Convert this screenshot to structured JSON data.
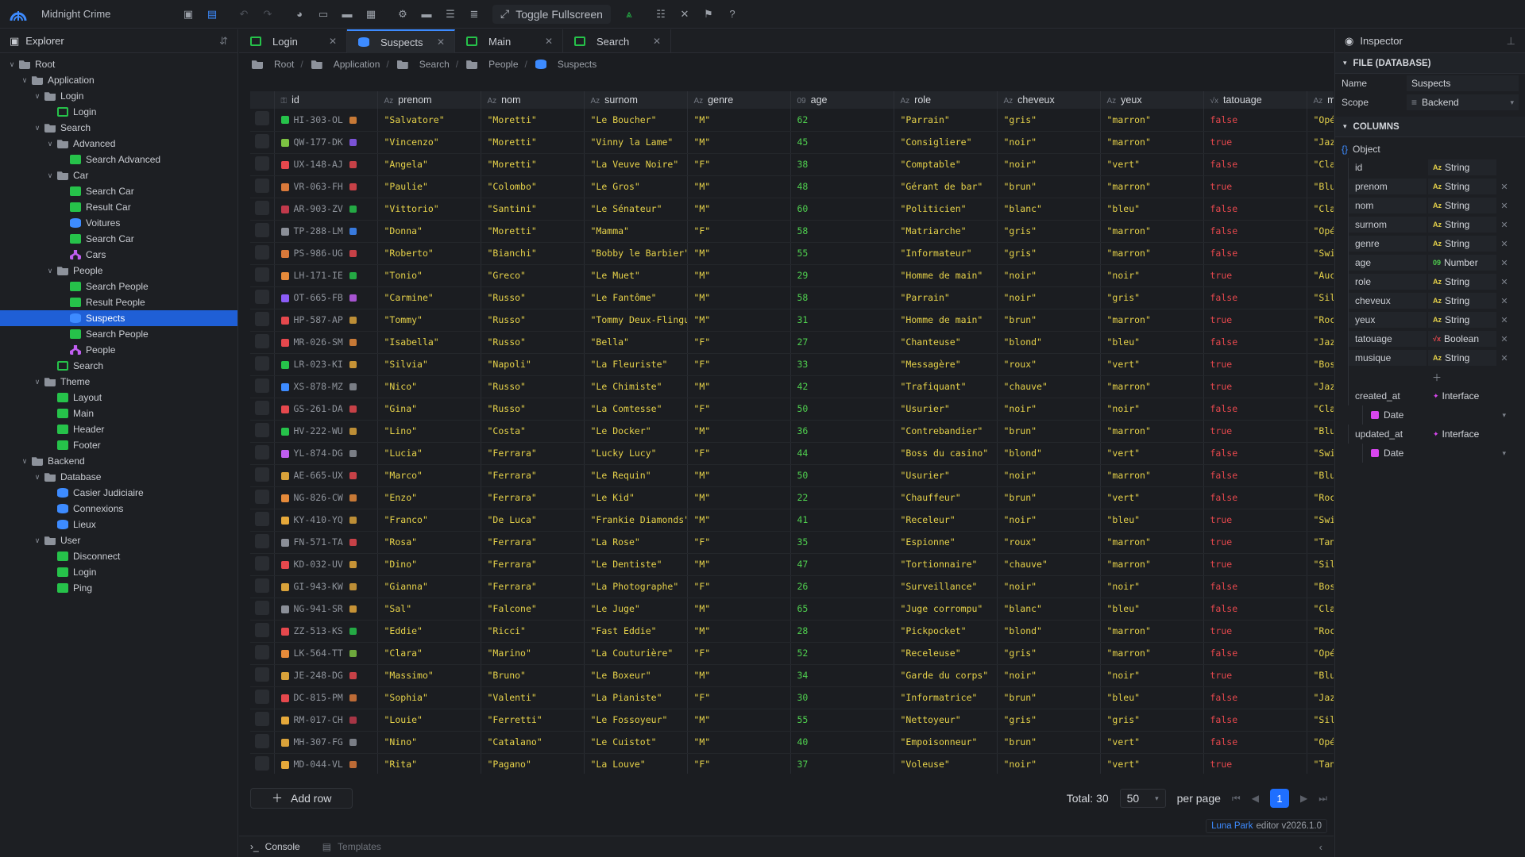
{
  "app": {
    "title": "Midnight Crime",
    "fullscreen_label": "Toggle Fullscreen"
  },
  "colors": {
    "accent": "#3d8bff",
    "page": "#26c24a",
    "db": "#3d8bff",
    "org": "#c05ef0",
    "string": "#e6d24a",
    "number": "#4fcf4f",
    "bool": "#e5484d"
  },
  "explorer": {
    "title": "Explorer",
    "tree": [
      {
        "label": "Root",
        "depth": 0,
        "icon": "folder",
        "open": true
      },
      {
        "label": "Application",
        "depth": 1,
        "icon": "folder",
        "open": true
      },
      {
        "label": "Login",
        "depth": 2,
        "icon": "folder",
        "open": true
      },
      {
        "label": "Login",
        "depth": 3,
        "icon": "outline"
      },
      {
        "label": "Search",
        "depth": 2,
        "icon": "folder",
        "open": true
      },
      {
        "label": "Advanced",
        "depth": 3,
        "icon": "folder",
        "open": true
      },
      {
        "label": "Search Advanced",
        "depth": 4,
        "icon": "page"
      },
      {
        "label": "Car",
        "depth": 3,
        "icon": "folder",
        "open": true
      },
      {
        "label": "Search Car",
        "depth": 4,
        "icon": "page"
      },
      {
        "label": "Result Car",
        "depth": 4,
        "icon": "page"
      },
      {
        "label": "Voitures",
        "depth": 4,
        "icon": "db"
      },
      {
        "label": "Search Car",
        "depth": 4,
        "icon": "page"
      },
      {
        "label": "Cars",
        "depth": 4,
        "icon": "org"
      },
      {
        "label": "People",
        "depth": 3,
        "icon": "folder",
        "open": true
      },
      {
        "label": "Search People",
        "depth": 4,
        "icon": "page"
      },
      {
        "label": "Result People",
        "depth": 4,
        "icon": "page"
      },
      {
        "label": "Suspects",
        "depth": 4,
        "icon": "db",
        "selected": true
      },
      {
        "label": "Search People",
        "depth": 4,
        "icon": "page"
      },
      {
        "label": "People",
        "depth": 4,
        "icon": "org"
      },
      {
        "label": "Search",
        "depth": 3,
        "icon": "outline"
      },
      {
        "label": "Theme",
        "depth": 2,
        "icon": "folder",
        "open": true
      },
      {
        "label": "Layout",
        "depth": 3,
        "icon": "page"
      },
      {
        "label": "Main",
        "depth": 3,
        "icon": "page"
      },
      {
        "label": "Header",
        "depth": 3,
        "icon": "page"
      },
      {
        "label": "Footer",
        "depth": 3,
        "icon": "page"
      },
      {
        "label": "Backend",
        "depth": 1,
        "icon": "folder",
        "open": true
      },
      {
        "label": "Database",
        "depth": 2,
        "icon": "folder",
        "open": true
      },
      {
        "label": "Casier Judiciaire",
        "depth": 3,
        "icon": "db"
      },
      {
        "label": "Connexions",
        "depth": 3,
        "icon": "db"
      },
      {
        "label": "Lieux",
        "depth": 3,
        "icon": "db"
      },
      {
        "label": "User",
        "depth": 2,
        "icon": "folder",
        "open": true
      },
      {
        "label": "Disconnect",
        "depth": 3,
        "icon": "page"
      },
      {
        "label": "Login",
        "depth": 3,
        "icon": "page"
      },
      {
        "label": "Ping",
        "depth": 3,
        "icon": "page"
      }
    ]
  },
  "tabs": [
    {
      "label": "Login",
      "icon": "page"
    },
    {
      "label": "Suspects",
      "icon": "db",
      "active": true
    },
    {
      "label": "Main",
      "icon": "page"
    },
    {
      "label": "Search",
      "icon": "page"
    }
  ],
  "breadcrumb": [
    "Root",
    "Application",
    "Search",
    "People",
    "Suspects"
  ],
  "table": {
    "columns": [
      {
        "name": "id",
        "type": "key"
      },
      {
        "name": "prenom",
        "type": "Az"
      },
      {
        "name": "nom",
        "type": "Az"
      },
      {
        "name": "surnom",
        "type": "Az"
      },
      {
        "name": "genre",
        "type": "Az"
      },
      {
        "name": "age",
        "type": "09"
      },
      {
        "name": "role",
        "type": "Az"
      },
      {
        "name": "cheveux",
        "type": "Az"
      },
      {
        "name": "yeux",
        "type": "Az"
      },
      {
        "name": "tatouage",
        "type": "√x"
      },
      {
        "name": "musique",
        "type": "Az"
      }
    ],
    "rows": [
      [
        "HI-303-OL",
        "\"Salvatore\"",
        "\"Moretti\"",
        "\"Le Boucher\"",
        "\"M\"",
        "62",
        "\"Parrain\"",
        "\"gris\"",
        "\"marron\"",
        "false",
        "\"Opéra\""
      ],
      [
        "QW-177-DK",
        "\"Vincenzo\"",
        "\"Moretti\"",
        "\"Vinny la Lame\"",
        "\"M\"",
        "45",
        "\"Consigliere\"",
        "\"noir\"",
        "\"marron\"",
        "true",
        "\"Jazz\""
      ],
      [
        "UX-148-AJ",
        "\"Angela\"",
        "\"Moretti\"",
        "\"La Veuve Noire\"",
        "\"F\"",
        "38",
        "\"Comptable\"",
        "\"noir\"",
        "\"vert\"",
        "false",
        "\"Classique\""
      ],
      [
        "VR-063-FH",
        "\"Paulie\"",
        "\"Colombo\"",
        "\"Le Gros\"",
        "\"M\"",
        "48",
        "\"Gérant de bar\"",
        "\"brun\"",
        "\"marron\"",
        "true",
        "\"Blues\""
      ],
      [
        "AR-903-ZV",
        "\"Vittorio\"",
        "\"Santini\"",
        "\"Le Sénateur\"",
        "\"M\"",
        "60",
        "\"Politicien\"",
        "\"blanc\"",
        "\"bleu\"",
        "false",
        "\"Classique\""
      ],
      [
        "TP-288-LM",
        "\"Donna\"",
        "\"Moretti\"",
        "\"Mamma\"",
        "\"F\"",
        "58",
        "\"Matriarche\"",
        "\"gris\"",
        "\"marron\"",
        "false",
        "\"Opéra\""
      ],
      [
        "PS-986-UG",
        "\"Roberto\"",
        "\"Bianchi\"",
        "\"Bobby le Barbier\"",
        "\"M\"",
        "55",
        "\"Informateur\"",
        "\"gris\"",
        "\"marron\"",
        "false",
        "\"Swing\""
      ],
      [
        "LH-171-IE",
        "\"Tonio\"",
        "\"Greco\"",
        "\"Le Muet\"",
        "\"M\"",
        "29",
        "\"Homme de main\"",
        "\"noir\"",
        "\"noir\"",
        "true",
        "\"Aucune\""
      ],
      [
        "OT-665-FB",
        "\"Carmine\"",
        "\"Russo\"",
        "\"Le Fantôme\"",
        "\"M\"",
        "58",
        "\"Parrain\"",
        "\"noir\"",
        "\"gris\"",
        "false",
        "\"Silence\""
      ],
      [
        "HP-587-AP",
        "\"Tommy\"",
        "\"Russo\"",
        "\"Tommy Deux-Flingues\"",
        "\"M\"",
        "31",
        "\"Homme de main\"",
        "\"brun\"",
        "\"marron\"",
        "true",
        "\"Rock'n'roll\""
      ],
      [
        "MR-026-SM",
        "\"Isabella\"",
        "\"Russo\"",
        "\"Bella\"",
        "\"F\"",
        "27",
        "\"Chanteuse\"",
        "\"blond\"",
        "\"bleu\"",
        "false",
        "\"Jazz\""
      ],
      [
        "LR-023-KI",
        "\"Silvia\"",
        "\"Napoli\"",
        "\"La Fleuriste\"",
        "\"F\"",
        "33",
        "\"Messagère\"",
        "\"roux\"",
        "\"vert\"",
        "true",
        "\"Bossa Nova\""
      ],
      [
        "XS-878-MZ",
        "\"Nico\"",
        "\"Russo\"",
        "\"Le Chimiste\"",
        "\"M\"",
        "42",
        "\"Trafiquant\"",
        "\"chauve\"",
        "\"marron\"",
        "true",
        "\"Jazz\""
      ],
      [
        "GS-261-DA",
        "\"Gina\"",
        "\"Russo\"",
        "\"La Comtesse\"",
        "\"F\"",
        "50",
        "\"Usurier\"",
        "\"noir\"",
        "\"noir\"",
        "false",
        "\"Classique\""
      ],
      [
        "HV-222-WU",
        "\"Lino\"",
        "\"Costa\"",
        "\"Le Docker\"",
        "\"M\"",
        "36",
        "\"Contrebandier\"",
        "\"brun\"",
        "\"marron\"",
        "true",
        "\"Blues\""
      ],
      [
        "YL-874-DG",
        "\"Lucia\"",
        "\"Ferrara\"",
        "\"Lucky Lucy\"",
        "\"F\"",
        "44",
        "\"Boss du casino\"",
        "\"blond\"",
        "\"vert\"",
        "false",
        "\"Swing\""
      ],
      [
        "AE-665-UX",
        "\"Marco\"",
        "\"Ferrara\"",
        "\"Le Requin\"",
        "\"M\"",
        "50",
        "\"Usurier\"",
        "\"noir\"",
        "\"marron\"",
        "false",
        "\"Blues\""
      ],
      [
        "NG-826-CW",
        "\"Enzo\"",
        "\"Ferrara\"",
        "\"Le Kid\"",
        "\"M\"",
        "22",
        "\"Chauffeur\"",
        "\"brun\"",
        "\"vert\"",
        "false",
        "\"Rock'n'roll\""
      ],
      [
        "KY-410-YQ",
        "\"Franco\"",
        "\"De Luca\"",
        "\"Frankie Diamonds\"",
        "\"M\"",
        "41",
        "\"Receleur\"",
        "\"noir\"",
        "\"bleu\"",
        "true",
        "\"Swing\""
      ],
      [
        "FN-571-TA",
        "\"Rosa\"",
        "\"Ferrara\"",
        "\"La Rose\"",
        "\"F\"",
        "35",
        "\"Espionne\"",
        "\"roux\"",
        "\"marron\"",
        "true",
        "\"Tango\""
      ],
      [
        "KD-032-UV",
        "\"Dino\"",
        "\"Ferrara\"",
        "\"Le Dentiste\"",
        "\"M\"",
        "47",
        "\"Tortionnaire\"",
        "\"chauve\"",
        "\"marron\"",
        "true",
        "\"Silence\""
      ],
      [
        "GI-943-KW",
        "\"Gianna\"",
        "\"Ferrara\"",
        "\"La Photographe\"",
        "\"F\"",
        "26",
        "\"Surveillance\"",
        "\"noir\"",
        "\"noir\"",
        "false",
        "\"Bossa Nova\""
      ],
      [
        "NG-941-SR",
        "\"Sal\"",
        "\"Falcone\"",
        "\"Le Juge\"",
        "\"M\"",
        "65",
        "\"Juge corrompu\"",
        "\"blanc\"",
        "\"bleu\"",
        "false",
        "\"Classique\""
      ],
      [
        "ZZ-513-KS",
        "\"Eddie\"",
        "\"Ricci\"",
        "\"Fast Eddie\"",
        "\"M\"",
        "28",
        "\"Pickpocket\"",
        "\"blond\"",
        "\"marron\"",
        "true",
        "\"Rock'n'roll\""
      ],
      [
        "LK-564-TT",
        "\"Clara\"",
        "\"Marino\"",
        "\"La Couturière\"",
        "\"F\"",
        "52",
        "\"Receleuse\"",
        "\"gris\"",
        "\"marron\"",
        "false",
        "\"Opéra\""
      ],
      [
        "JE-248-DG",
        "\"Massimo\"",
        "\"Bruno\"",
        "\"Le Boxeur\"",
        "\"M\"",
        "34",
        "\"Garde du corps\"",
        "\"noir\"",
        "\"noir\"",
        "true",
        "\"Blues\""
      ],
      [
        "DC-815-PM",
        "\"Sophia\"",
        "\"Valenti\"",
        "\"La Pianiste\"",
        "\"F\"",
        "30",
        "\"Informatrice\"",
        "\"brun\"",
        "\"bleu\"",
        "false",
        "\"Jazz\""
      ],
      [
        "RM-017-CH",
        "\"Louie\"",
        "\"Ferretti\"",
        "\"Le Fossoyeur\"",
        "\"M\"",
        "55",
        "\"Nettoyeur\"",
        "\"gris\"",
        "\"gris\"",
        "false",
        "\"Silence\""
      ],
      [
        "MH-307-FG",
        "\"Nino\"",
        "\"Catalano\"",
        "\"Le Cuistot\"",
        "\"M\"",
        "40",
        "\"Empoisonneur\"",
        "\"brun\"",
        "\"vert\"",
        "false",
        "\"Opéra\""
      ],
      [
        "MD-044-VL",
        "\"Rita\"",
        "\"Pagano\"",
        "\"La Louve\"",
        "\"F\"",
        "37",
        "\"Voleuse\"",
        "\"noir\"",
        "\"vert\"",
        "true",
        "\"Tango\""
      ]
    ],
    "row_icon_colors": [
      "#26c24a",
      "#7cc242",
      "#e5484d",
      "#d9793a",
      "#c0394b",
      "#8b8f98",
      "#d9793a",
      "#e58a3a",
      "#8b5cf6",
      "#e5484d",
      "#e5484d",
      "#26c24a",
      "#3d8bff",
      "#e5484d",
      "#26c24a",
      "#c05ef0",
      "#d9a23a",
      "#e58a3a",
      "#e5a83a",
      "#8b8f98",
      "#e5484d",
      "#d9a23a",
      "#8b8f98",
      "#e5484d",
      "#e58a3a",
      "#d9a23a",
      "#e5484d",
      "#e5a83a",
      "#d9a23a",
      "#e5a83a"
    ]
  },
  "footer": {
    "add_row": "Add row",
    "total": "Total: 30",
    "per_page_value": "50",
    "per_page_label": "per page",
    "page": "1"
  },
  "version": {
    "brand": "Luna Park",
    "text": "editor v2026.1.0"
  },
  "bottom": {
    "console": "Console",
    "templates": "Templates"
  },
  "inspector": {
    "title": "Inspector",
    "file_section": "FILE (DATABASE)",
    "name_label": "Name",
    "name_value": "Suspects",
    "scope_label": "Scope",
    "scope_value": "Backend",
    "columns_section": "COLUMNS",
    "object_label": "Object",
    "columns": [
      {
        "name": "id",
        "type": "String",
        "tag": "s",
        "fixed": true
      },
      {
        "name": "prenom",
        "type": "String",
        "tag": "s"
      },
      {
        "name": "nom",
        "type": "String",
        "tag": "s"
      },
      {
        "name": "surnom",
        "type": "String",
        "tag": "s"
      },
      {
        "name": "genre",
        "type": "String",
        "tag": "s"
      },
      {
        "name": "age",
        "type": "Number",
        "tag": "n"
      },
      {
        "name": "role",
        "type": "String",
        "tag": "s"
      },
      {
        "name": "cheveux",
        "type": "String",
        "tag": "s"
      },
      {
        "name": "yeux",
        "type": "String",
        "tag": "s"
      },
      {
        "name": "tatouage",
        "type": "Boolean",
        "tag": "b"
      },
      {
        "name": "musique",
        "type": "String",
        "tag": "s"
      }
    ],
    "extra": [
      {
        "name": "created_at",
        "type": "Interface",
        "sub": "Date"
      },
      {
        "name": "updated_at",
        "type": "Interface",
        "sub": "Date"
      }
    ]
  }
}
